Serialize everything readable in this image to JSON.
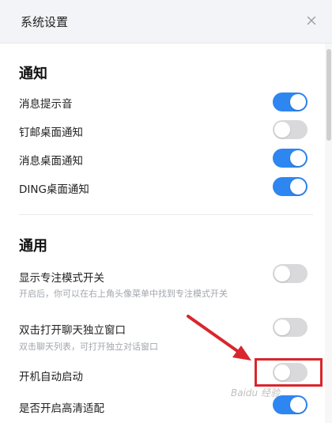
{
  "window": {
    "title": "系统设置",
    "close_icon": "close-icon"
  },
  "notifications": {
    "section_title": "通知",
    "items": [
      {
        "label": "消息提示音",
        "enabled": true
      },
      {
        "label": "钉邮桌面通知",
        "enabled": false
      },
      {
        "label": "消息桌面通知",
        "enabled": true
      },
      {
        "label": "DING桌面通知",
        "enabled": true
      }
    ]
  },
  "general": {
    "section_title": "通用",
    "items": [
      {
        "label": "显示专注模式开关",
        "description": "开启后，你可以在右上角头像菜单中找到专注模式开关",
        "enabled": false
      },
      {
        "label": "双击打开聊天独立窗口",
        "description": "双击聊天列表，可打开独立对话窗口",
        "enabled": false
      },
      {
        "label": "开机自动启动",
        "description": "",
        "enabled": false
      },
      {
        "label": "是否开启高清适配",
        "description": "",
        "enabled": true
      }
    ]
  },
  "annotation": {
    "highlight_color": "#d9262c",
    "arrow_color": "#d9262c"
  },
  "colors": {
    "toggle_on": "#2e86f0",
    "toggle_off": "#d9d9db",
    "title_bar_bg": "#f3f4f7"
  }
}
